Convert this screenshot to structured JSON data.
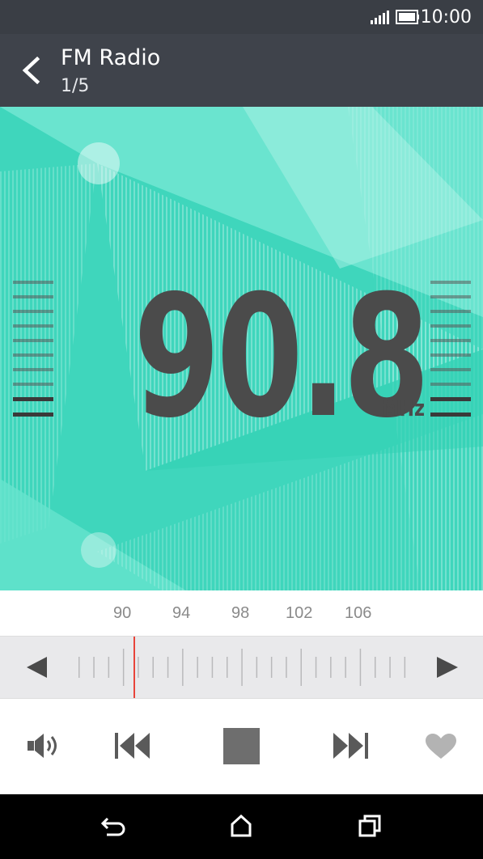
{
  "status_bar": {
    "time": "10:00",
    "signal_icon": "signal-bars-icon",
    "battery_icon": "battery-icon"
  },
  "header": {
    "title": "FM Radio",
    "subtitle": "1/5",
    "back_icon": "chevron-left-icon"
  },
  "station": {
    "frequency": "90.8",
    "unit": "MHz"
  },
  "dial": {
    "tick_labels": [
      "90",
      "94",
      "98",
      "102",
      "106"
    ],
    "indicator_color": "#e8443a"
  },
  "colors": {
    "accent": "#48dcc2",
    "header": "#3f434b",
    "status": "#3a3e45",
    "digits": "#4b4b4b"
  },
  "controls": {
    "volume_icon": "volume-icon",
    "prev_icon": "skip-previous-icon",
    "stop_icon": "stop-icon",
    "next_icon": "skip-next-icon",
    "favorite_icon": "heart-icon"
  },
  "nav": {
    "back_icon": "nav-back-icon",
    "home_icon": "nav-home-icon",
    "recents_icon": "nav-recents-icon"
  }
}
